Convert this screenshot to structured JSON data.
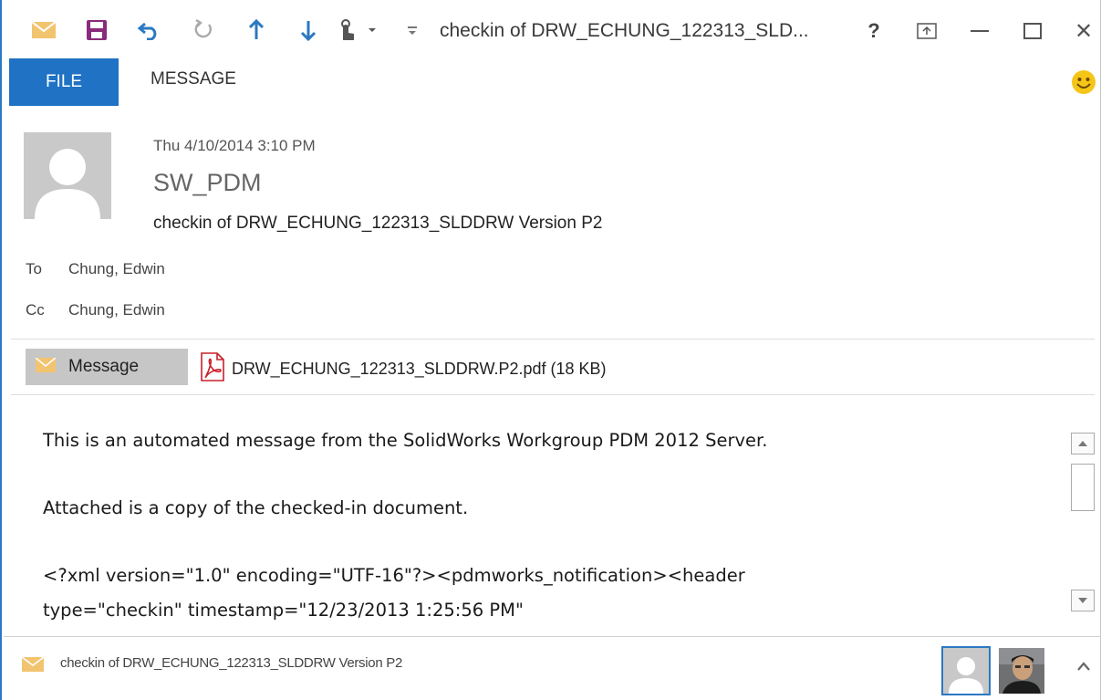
{
  "window": {
    "title": "checkin of DRW_ECHUNG_122313_SLD...",
    "help_label": "?",
    "restore_ribbon_icon": "ribbon-display-icon",
    "minimize_icon": "minimize-icon",
    "maximize_icon": "maximize-icon",
    "close_label": "✕"
  },
  "quick_access": [
    "envelope-icon",
    "save-icon",
    "undo-icon",
    "redo-icon",
    "up-arrow-icon",
    "down-arrow-icon",
    "touch-mode-icon",
    "customize-icon"
  ],
  "ribbon": {
    "file_tab": "FILE",
    "message_tab": "MESSAGE"
  },
  "header": {
    "date": "Thu 4/10/2014 3:10 PM",
    "from": "SW_PDM",
    "subject": "checkin of DRW_ECHUNG_122313_SLDDRW Version P2",
    "to_label": "To",
    "to_name": "Chung, Edwin",
    "cc_label": "Cc",
    "cc_name": "Chung, Edwin"
  },
  "attachments": {
    "message_label": "Message",
    "file_label": "DRW_ECHUNG_122313_SLDDRW.P2.pdf (18 KB)"
  },
  "body": {
    "line1": "This is an automated message from the SolidWorks Workgroup PDM 2012 Server.",
    "line2": "Attached is a copy of the checked-in document.",
    "line3": "<?xml version=\"1.0\" encoding=\"UTF-16\"?><pdmworks_notification><header",
    "line4": "type=\"checkin\" timestamp=\"12/23/2013 1:25:56 PM\""
  },
  "footer": {
    "subject": "checkin of DRW_ECHUNG_122313_SLDDRW Version P2"
  },
  "colors": {
    "accent": "#1f72c4",
    "envelope": "#f2c46f",
    "pdf_red": "#c8202a",
    "smiley": "#f5c518"
  }
}
